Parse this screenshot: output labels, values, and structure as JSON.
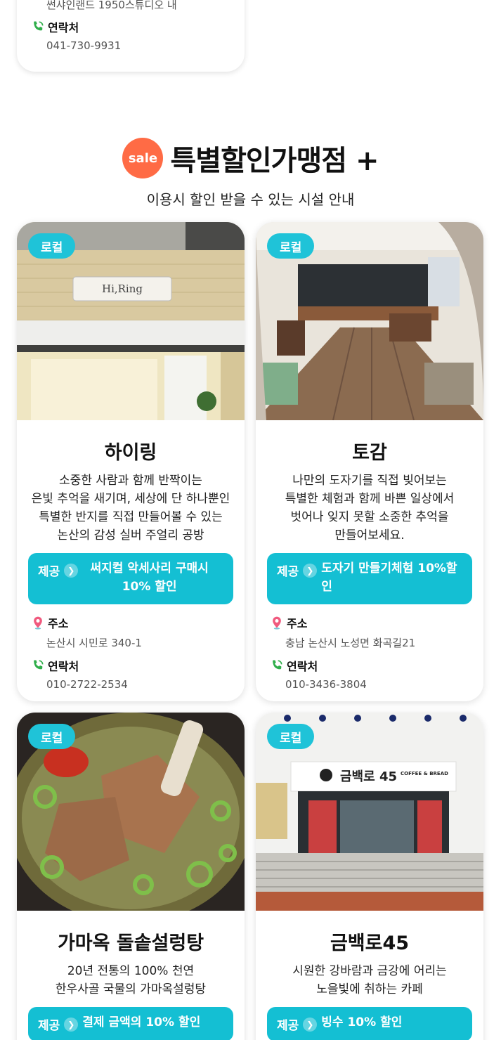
{
  "top_card": {
    "address_cut": "썬샤인랜드 1950스튜디오 내",
    "contact_label": "연락처",
    "contact_value": "041-730-9931"
  },
  "section": {
    "badge": "sale",
    "title": "특별할인가맹점 +",
    "subtitle": "이용시 할인 받을 수 있는 시설 안내"
  },
  "labels": {
    "address": "주소",
    "contact": "연락처",
    "provide": "제공"
  },
  "cards": [
    {
      "badge": "로컬",
      "sign": "Hi,Ring",
      "title": "하이링",
      "desc": [
        "소중한 사람과 함께 반짝이는",
        "은빛 추억을 새기며, 세상에 단 하나뿐인",
        "특별한 반지를 직접 만들어볼 수 있는",
        "논산의 감성 실버 주얼리 공방"
      ],
      "offer": "써지컬 악세사리 구매시 10% 할인",
      "address": "논산시 시민로 340-1",
      "contact": "010-2722-2534"
    },
    {
      "badge": "로컬",
      "title": "토감",
      "desc": [
        "나만의 도자기를 직접 빚어보는",
        "특별한 체험과 함께 바쁜 일상에서",
        "벗어나 잊지 못할 소중한 추억을",
        "만들어보세요."
      ],
      "offer": "도자기 만들기체험 10%할인",
      "address": "충남 논산시 노성면 화곡길21",
      "contact": "010-3436-3804"
    },
    {
      "badge": "로컬",
      "title": "가마옥 돌솥설렁탕",
      "desc": [
        "20년 전통의 100% 천연",
        "한우사골 국물의 가마옥설렁탕"
      ],
      "offer": "결제 금액의 10% 할인"
    },
    {
      "badge": "로컬",
      "sign": "금백로 45",
      "sign_sub": "COFFEE & BREAD",
      "title": "금백로45",
      "desc": [
        "시원한 강바람과 금강에 어리는",
        "노을빛에 취하는 카페"
      ],
      "offer": "빙수 10% 할인"
    }
  ],
  "colors": {
    "accent": "#14bfd3",
    "badge": "#1fc3d8",
    "sale": "#ff6b45"
  }
}
